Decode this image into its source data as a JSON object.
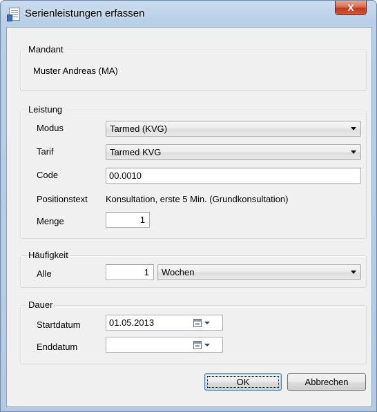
{
  "window": {
    "title": "Serienleistungen erfassen",
    "close_label": "X"
  },
  "mandant": {
    "group_label": "Mandant",
    "value": "Muster Andreas (MA)"
  },
  "leistung": {
    "group_label": "Leistung",
    "modus_label": "Modus",
    "modus_value": "Tarmed (KVG)",
    "tarif_label": "Tarif",
    "tarif_value": "Tarmed KVG",
    "code_label": "Code",
    "code_value": "00.0010",
    "positionstext_label": "Positionstext",
    "positionstext_value": "Konsultation, erste 5 Min. (Grundkonsultation)",
    "menge_label": "Menge",
    "menge_value": "1"
  },
  "haeufigkeit": {
    "group_label": "Häufigkeit",
    "alle_label": "Alle",
    "alle_value": "1",
    "interval_value": "Wochen"
  },
  "dauer": {
    "group_label": "Dauer",
    "start_label": "Startdatum",
    "start_value": "01.05.2013",
    "end_label": "Enddatum",
    "end_value": ""
  },
  "buttons": {
    "ok_label": "OK",
    "cancel_label": "Abbrechen"
  },
  "icons": {
    "window_icon": "document-list-icon",
    "close": "close-icon",
    "calendar": "calendar-icon",
    "dropdown": "chevron-down-icon"
  },
  "colors": {
    "close_button": "#c7452a",
    "title_bar": "#bcd2ea",
    "dialog_bg": "#f0f0f0",
    "default_button_border": "#3c7fb1"
  }
}
